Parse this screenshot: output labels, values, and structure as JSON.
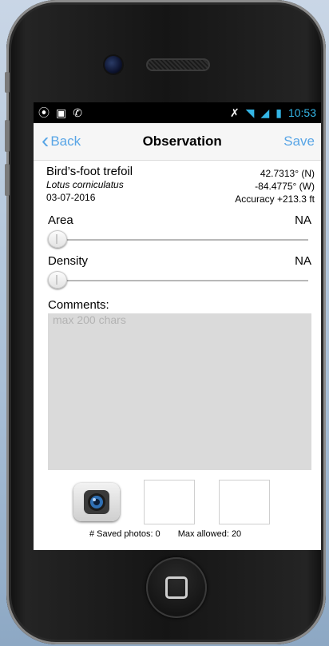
{
  "status": {
    "time": "10:53"
  },
  "nav": {
    "back": "Back",
    "title": "Observation",
    "save": "Save"
  },
  "species": {
    "common_name": "Bird’s-foot trefoil",
    "scientific_name": "Lotus corniculatus",
    "date": "03-07-2016"
  },
  "location": {
    "lat": "42.7313° (N)",
    "lon": "-84.4775° (W)",
    "accuracy": "Accuracy +213.3 ft"
  },
  "area": {
    "label": "Area",
    "value": "NA",
    "slider_level": 0
  },
  "density": {
    "label": "Density",
    "value": "NA",
    "slider_level": 0
  },
  "comments": {
    "label": "Comments:",
    "placeholder": "max 200 chars"
  },
  "photos": {
    "saved": "# Saved photos: 0",
    "max": "Max allowed: 20"
  },
  "colors": {
    "accent": "#58a5e6",
    "comments_bg": "#dadada"
  }
}
